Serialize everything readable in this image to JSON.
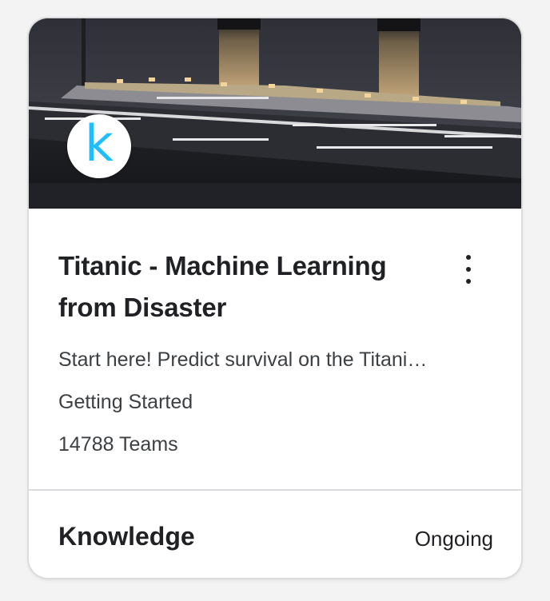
{
  "competition": {
    "logo_letter": "k",
    "title": "Titanic - Machine Learning from Disaster",
    "description": "Start here! Predict survival on the Titani…",
    "category": "Getting Started",
    "teams": "14788 Teams",
    "prize_label": "Knowledge",
    "status": "Ongoing"
  },
  "icons": {
    "menu": "more-vertical-icon",
    "logo": "kaggle-logo"
  },
  "colors": {
    "logo_accent": "#20beff",
    "text_primary": "#202124",
    "text_secondary": "#3c4043"
  }
}
